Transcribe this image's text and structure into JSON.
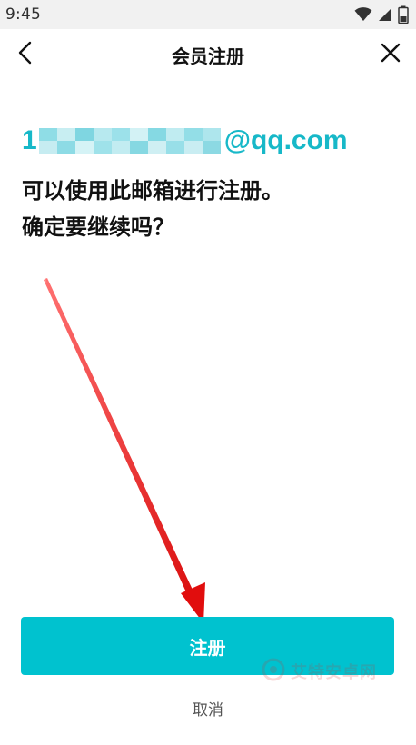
{
  "status_bar": {
    "time": "9:45",
    "icons": [
      "wifi-icon",
      "cell-signal-icon",
      "battery-icon"
    ]
  },
  "nav": {
    "title": "会员注册",
    "back_icon": "back-chevron-icon",
    "close_icon": "close-icon"
  },
  "content": {
    "email_prefix": "1",
    "email_domain": "@qq.com",
    "message_line1": "可以使用此邮箱进行注册。",
    "message_line2": "确定要继续吗？"
  },
  "actions": {
    "register_label": "注册",
    "cancel_label": "取消"
  },
  "watermark": {
    "text": "艾特安卓网"
  },
  "colors": {
    "accent": "#00c2cf",
    "email_text": "#17b8c8",
    "annotation_arrow": "#e51313"
  }
}
